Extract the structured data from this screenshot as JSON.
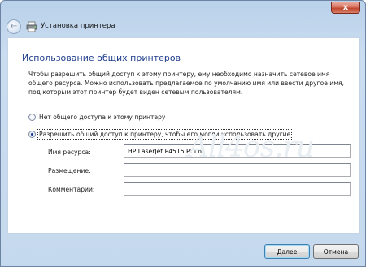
{
  "window": {
    "title": "Установка принтера",
    "close_label": "x"
  },
  "page": {
    "heading": "Использование общих принтеров",
    "description": "Чтобы разрешить общий доступ к этому принтеру, ему необходимо назначить сетевое имя общего ресурса. Можно использовать предлагаемое по умолчанию имя или ввести другое имя, под которым этот принтер будет виден сетевым пользователям."
  },
  "sharing": {
    "option_no_share": "Нет общего доступа к этому принтеру",
    "option_share": "Разрешить общий доступ к принтеру, чтобы его могли использовать другие",
    "selected": "share"
  },
  "fields": {
    "share_name_label": "Имя ресурса:",
    "share_name_value": "HP LaserJet P4515 PCL6",
    "location_label": "Размещение:",
    "location_value": "",
    "comment_label": "Комментарий:",
    "comment_value": ""
  },
  "watermark": "All4os.ru",
  "buttons": {
    "next": "Далее",
    "cancel": "Отмена"
  },
  "icons": {
    "back": "back-arrow-icon",
    "printer": "printer-icon",
    "close": "close-icon"
  }
}
